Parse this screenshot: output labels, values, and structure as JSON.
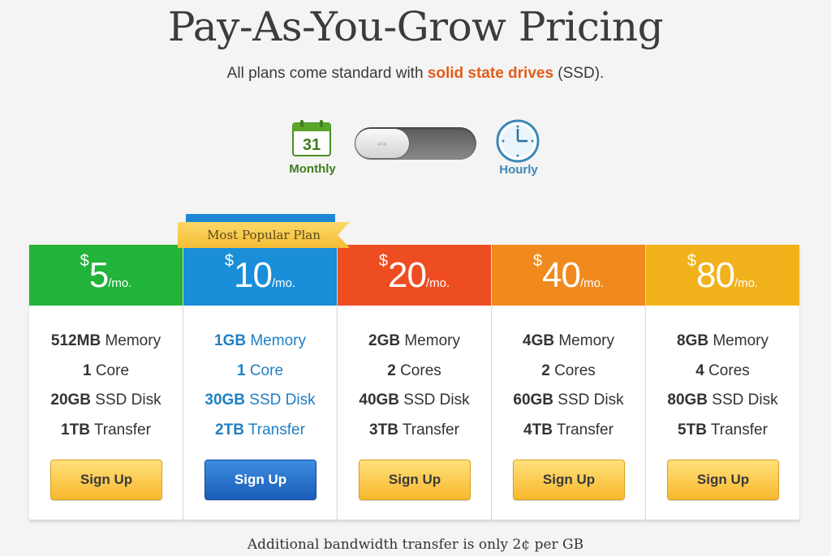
{
  "header": {
    "title": "Pay-As-You-Grow Pricing",
    "subtitle_pre": "All plans come standard with ",
    "subtitle_highlight": "solid state drives",
    "subtitle_post": " (SSD)."
  },
  "billing_toggle": {
    "calendar_day": "31",
    "monthly_label": "Monthly",
    "hourly_label": "Hourly",
    "knob_symbol": "⇔",
    "selected": "Monthly"
  },
  "ribbon": {
    "label": "Most Popular Plan"
  },
  "plans": [
    {
      "currency": "$",
      "amount": "5",
      "period": "/mo.",
      "color": "#22b33a",
      "memory_val": "512MB",
      "memory_label": " Memory",
      "core_val": "1",
      "core_label": " Core",
      "disk_val": "20GB",
      "disk_label": " SSD Disk",
      "transfer_val": "1TB",
      "transfer_label": " Transfer",
      "button": "Sign Up"
    },
    {
      "currency": "$",
      "amount": "10",
      "period": "/mo.",
      "color": "#1a8ed8",
      "memory_val": "1GB",
      "memory_label": " Memory",
      "core_val": "1",
      "core_label": " Core",
      "disk_val": "30GB",
      "disk_label": " SSD Disk",
      "transfer_val": "2TB",
      "transfer_label": " Transfer",
      "button": "Sign Up"
    },
    {
      "currency": "$",
      "amount": "20",
      "period": "/mo.",
      "color": "#ee4d22",
      "memory_val": "2GB",
      "memory_label": " Memory",
      "core_val": "2",
      "core_label": " Cores",
      "disk_val": "40GB",
      "disk_label": " SSD Disk",
      "transfer_val": "3TB",
      "transfer_label": " Transfer",
      "button": "Sign Up"
    },
    {
      "currency": "$",
      "amount": "40",
      "period": "/mo.",
      "color": "#f08a1e",
      "memory_val": "4GB",
      "memory_label": " Memory",
      "core_val": "2",
      "core_label": " Cores",
      "disk_val": "60GB",
      "disk_label": " SSD Disk",
      "transfer_val": "4TB",
      "transfer_label": " Transfer",
      "button": "Sign Up"
    },
    {
      "currency": "$",
      "amount": "80",
      "period": "/mo.",
      "color": "#f2b21b",
      "memory_val": "8GB",
      "memory_label": " Memory",
      "core_val": "4",
      "core_label": " Cores",
      "disk_val": "80GB",
      "disk_label": " SSD Disk",
      "transfer_val": "5TB",
      "transfer_label": " Transfer",
      "button": "Sign Up"
    }
  ],
  "footer": {
    "text": "Additional bandwidth transfer is only 2¢ per GB"
  }
}
